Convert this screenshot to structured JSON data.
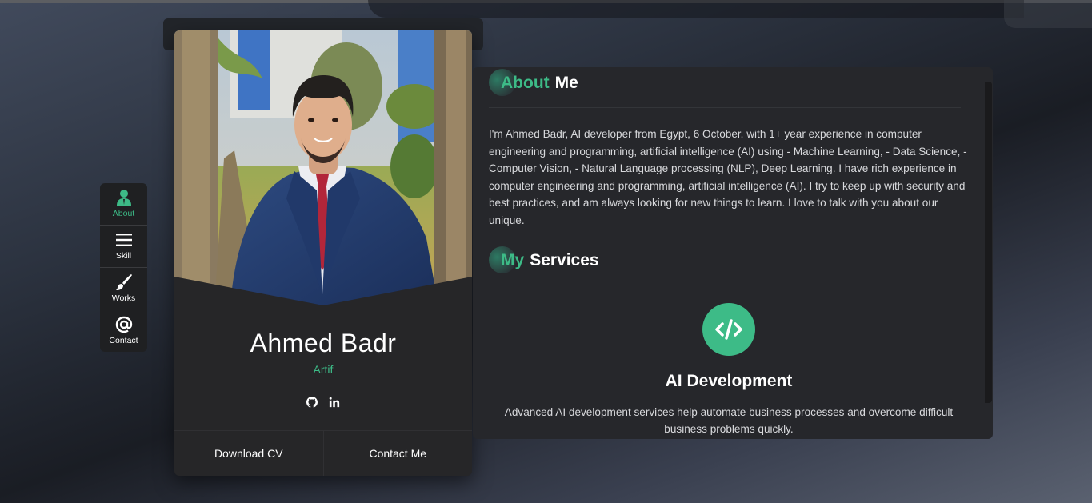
{
  "colors": {
    "accent": "#3dbb87",
    "card": "#262628",
    "panel": "#26272b",
    "nav": "#1f2022"
  },
  "nav": {
    "items": [
      {
        "label": "About",
        "icon": "user-icon",
        "active": true
      },
      {
        "label": "Skill",
        "icon": "menu-icon",
        "active": false
      },
      {
        "label": "Works",
        "icon": "brush-icon",
        "active": false
      },
      {
        "label": "Contact",
        "icon": "at-icon",
        "active": false
      }
    ]
  },
  "profile": {
    "name": "Ahmed Badr",
    "role": "Artif",
    "socials": [
      {
        "icon": "github-icon"
      },
      {
        "icon": "linkedin-icon"
      }
    ],
    "download_cv": "Download CV",
    "contact_me": "Contact Me"
  },
  "about": {
    "title_accent": "About",
    "title_rest": "Me",
    "text": "I'm Ahmed Badr, AI developer from Egypt, 6 October. with 1+ year experience in computer engineering and programming, artificial intelligence (AI) using - Machine Learning, - Data Science, - Computer Vision, - Natural Language processing (NLP), Deep Learning. I have rich experience in computer engineering and programming, artificial intelligence (AI). I try to keep up with security and best practices, and am always looking for new things to learn. I love to talk with you about our unique."
  },
  "services": {
    "title_accent": "My",
    "title_rest": "Services",
    "items": [
      {
        "icon": "code-icon",
        "title": "AI Development",
        "description": "Advanced AI development services help automate business processes and overcome difficult business problems quickly."
      }
    ]
  }
}
